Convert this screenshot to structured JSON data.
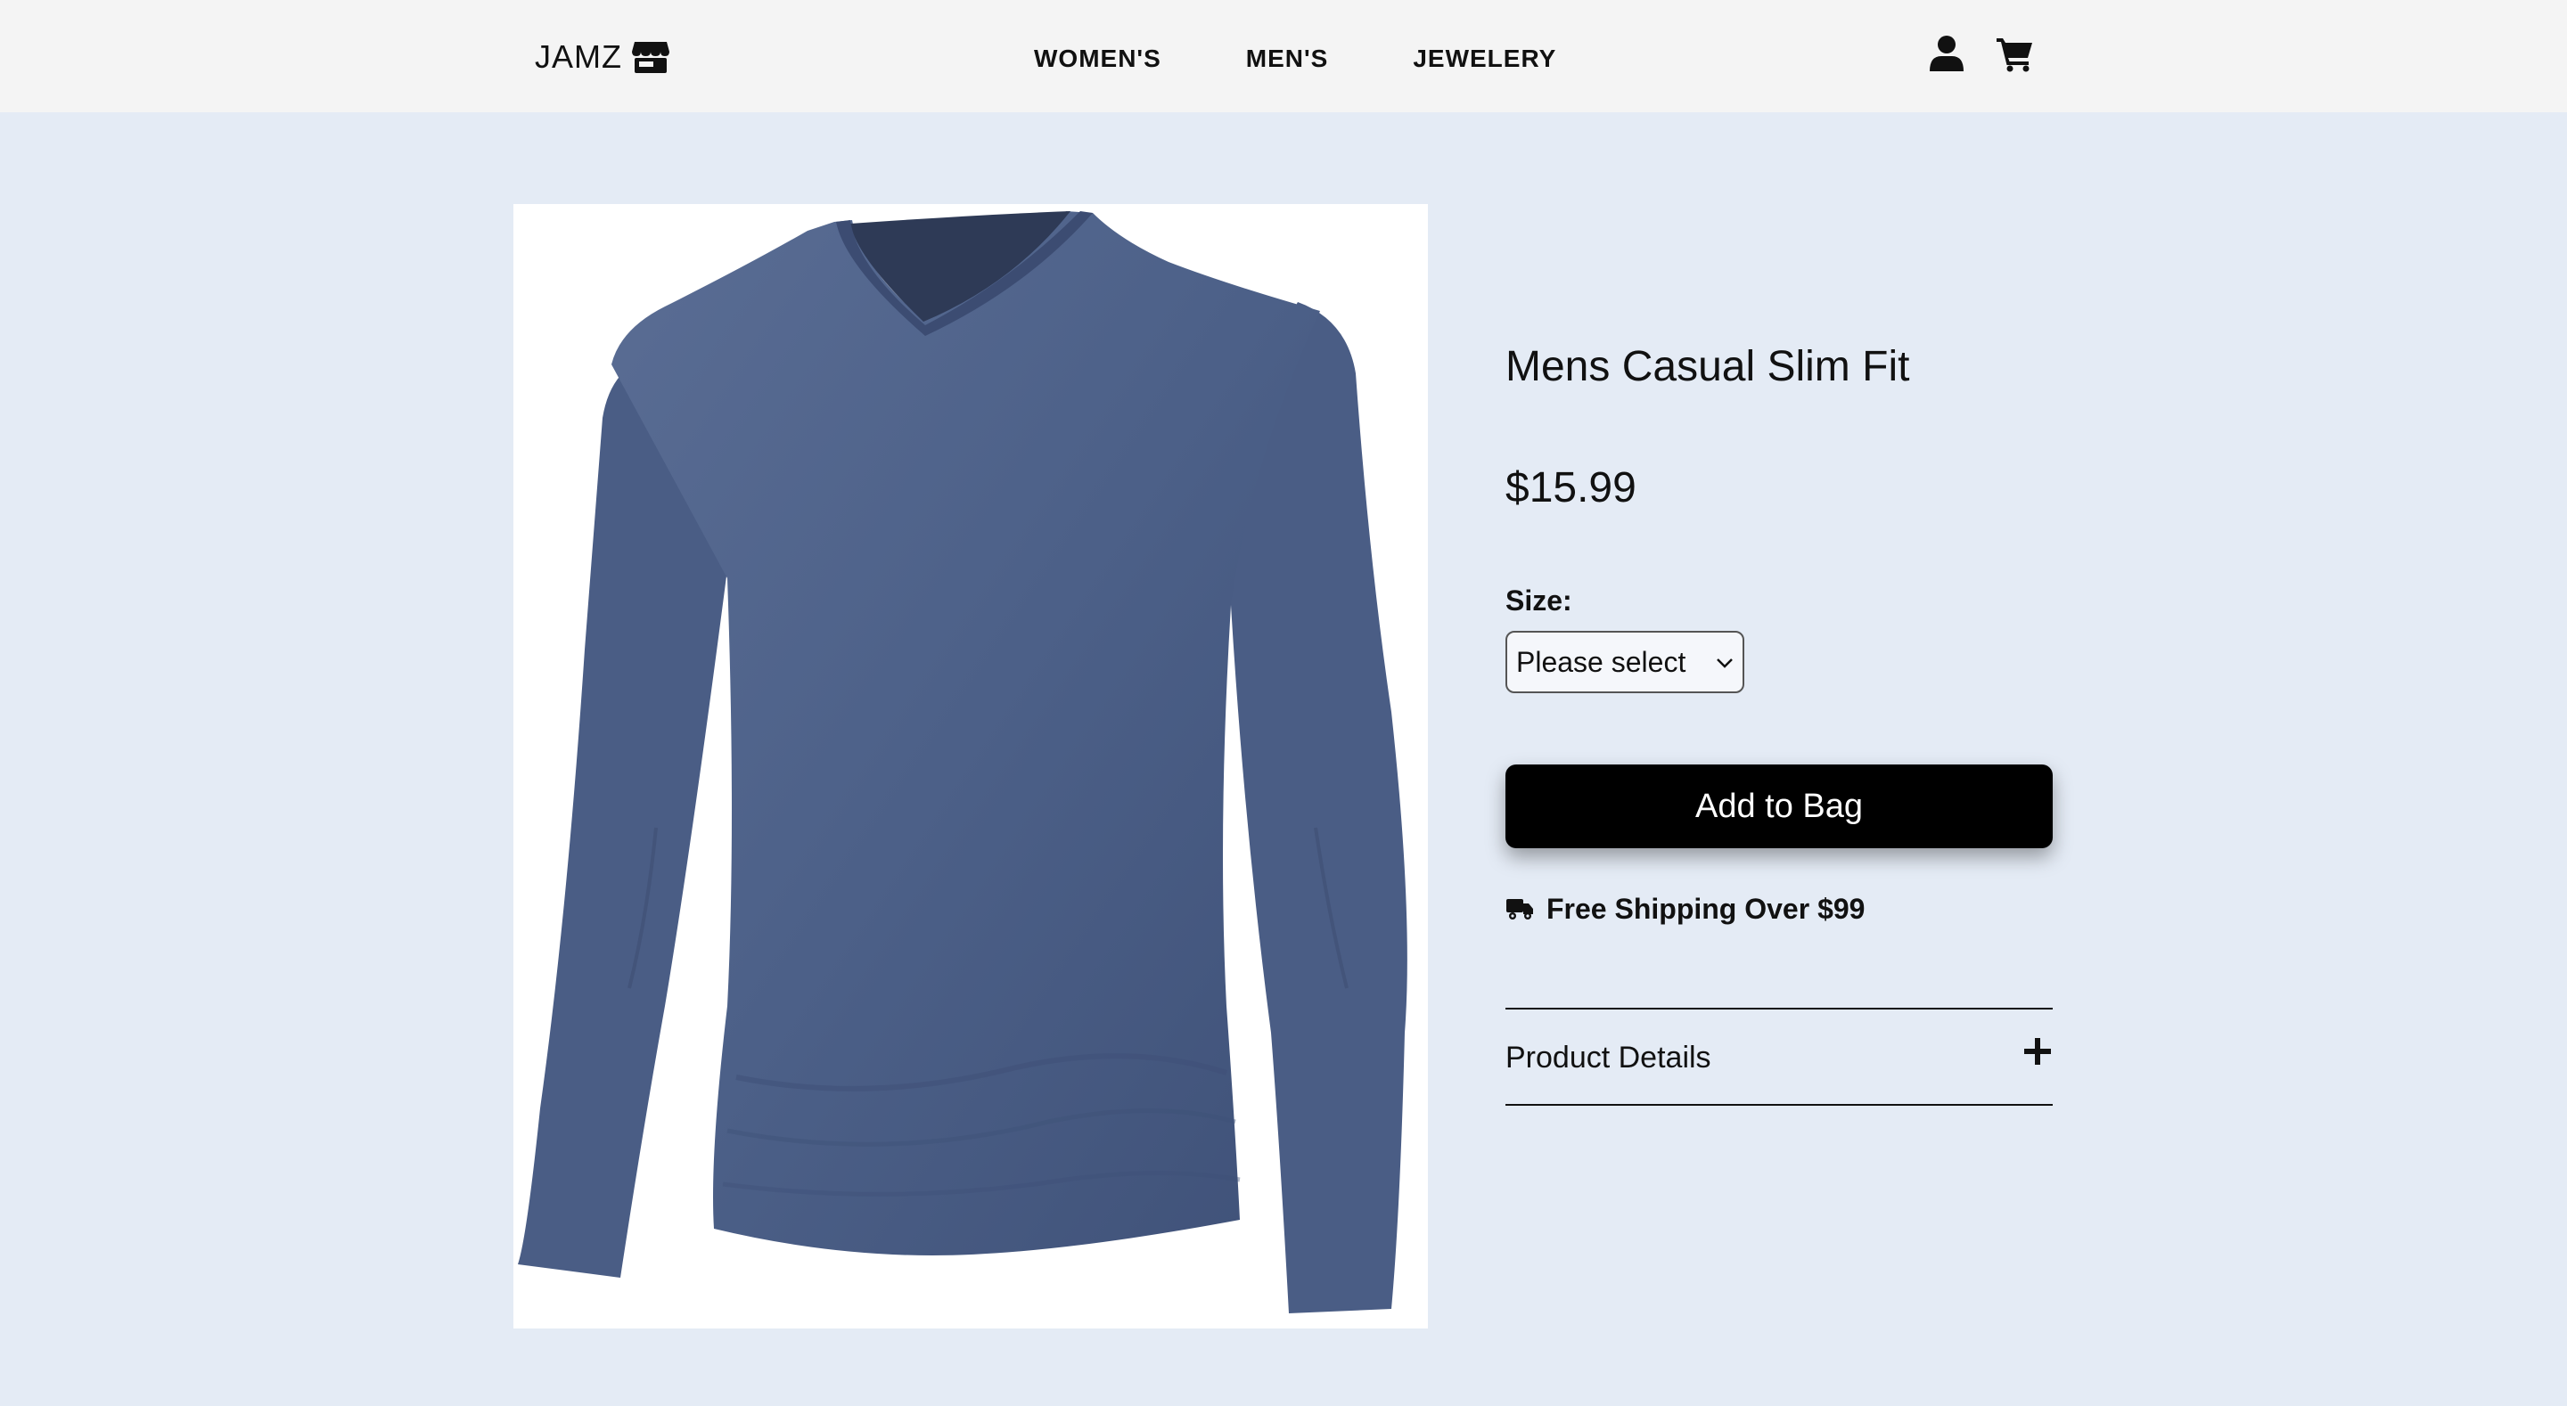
{
  "header": {
    "logo_text": "JAMZ",
    "logo_icon": "store-icon",
    "nav": [
      {
        "label": "WOMEN'S"
      },
      {
        "label": "MEN'S"
      },
      {
        "label": "JEWELERY"
      }
    ],
    "icons": [
      "user-icon",
      "cart-icon"
    ]
  },
  "product": {
    "image_alt": "blue long sleeve v-neck t-shirt",
    "title": "Mens Casual Slim Fit",
    "price": "$15.99",
    "size_label": "Size:",
    "size_select": {
      "selected": "Please select"
    },
    "add_button_label": "Add to Bag",
    "shipping_text": "Free Shipping Over $99",
    "shipping_icon": "truck-icon",
    "details_label": "Product Details",
    "details_icon": "plus-icon"
  },
  "colors": {
    "page_bg": "#e4ebf5",
    "header_bg": "#f4f4f4",
    "button_bg": "#000000",
    "shirt": "#4c6088"
  }
}
